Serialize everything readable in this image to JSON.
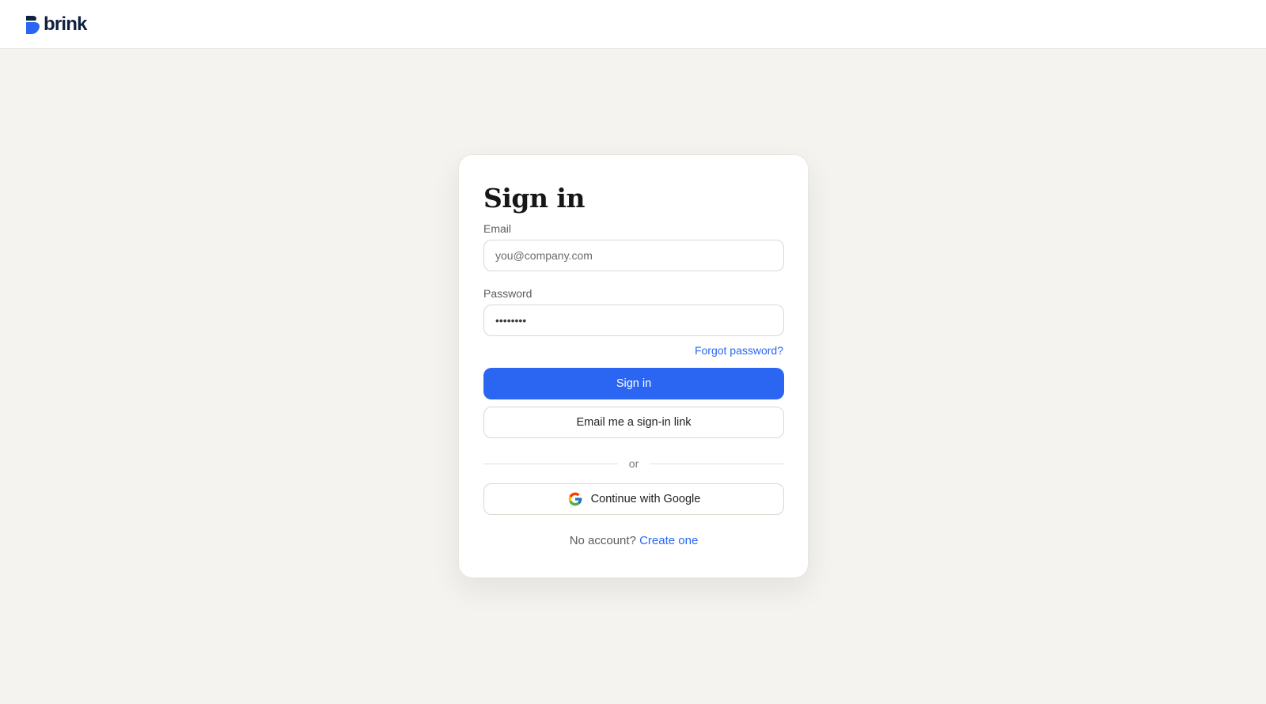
{
  "brand": {
    "name": "brink",
    "accent": "#2a66f2",
    "logo_color": "#10213f"
  },
  "signin": {
    "title": "Sign in",
    "email_label": "Email",
    "email_placeholder": "you@company.com",
    "email_value": "",
    "password_label": "Password",
    "password_value": "password",
    "forgot_password": "Forgot password?",
    "submit_label": "Sign in",
    "magic_link_label": "Email me a sign-in link",
    "divider_text": "or",
    "google_label": "Continue with Google",
    "google_icon": "google-g-icon",
    "no_account_text": "No account?",
    "create_account_link": "Create one"
  }
}
